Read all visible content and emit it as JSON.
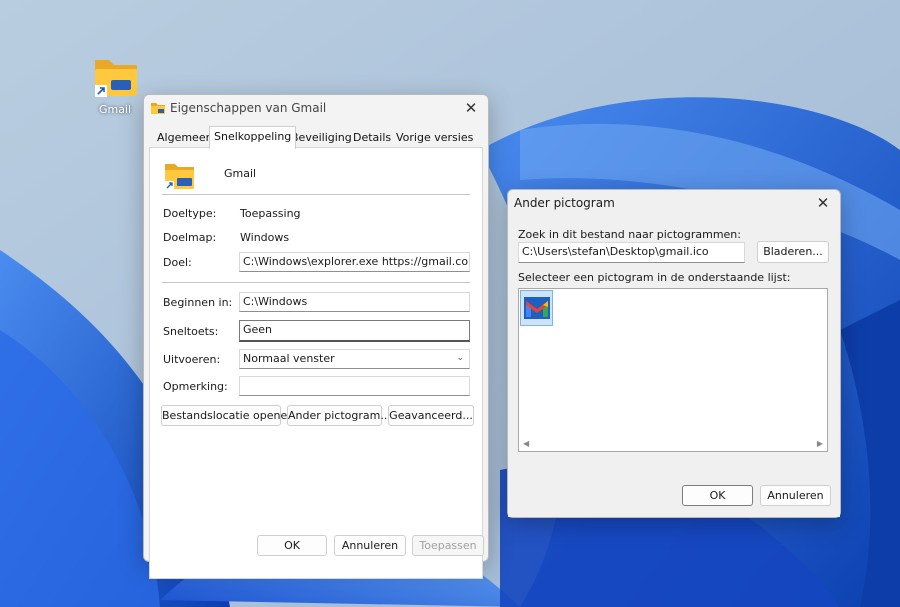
{
  "desktop": {
    "shortcut_label": "Gmail"
  },
  "properties_dialog": {
    "title": "Eigenschappen van Gmail",
    "tabs": [
      {
        "label": "Algemeen",
        "active": false
      },
      {
        "label": "Snelkoppeling",
        "active": true
      },
      {
        "label": "Beveiliging",
        "active": false
      },
      {
        "label": "Details",
        "active": false
      },
      {
        "label": "Vorige versies",
        "active": false
      }
    ],
    "name": "Gmail",
    "target_type_label": "Doeltype:",
    "target_type_value": "Toepassing",
    "target_location_label": "Doelmap:",
    "target_location_value": "Windows",
    "target_label": "Doel:",
    "target_value": "C:\\Windows\\explorer.exe https://gmail.com/",
    "start_in_label": "Beginnen in:",
    "start_in_value": "C:\\Windows",
    "shortcut_key_label": "Sneltoets:",
    "shortcut_key_value": "Geen",
    "run_label": "Uitvoeren:",
    "run_value": "Normaal venster",
    "comment_label": "Opmerking:",
    "comment_value": "",
    "open_location_button": "Bestandslocatie openen",
    "change_icon_button": "Ander pictogram...",
    "advanced_button": "Geavanceerd...",
    "ok_button": "OK",
    "cancel_button": "Annuleren",
    "apply_button": "Toepassen"
  },
  "change_icon_dialog": {
    "title": "Ander pictogram",
    "search_label": "Zoek in dit bestand naar pictogrammen:",
    "file_path": "C:\\Users\\stefan\\Desktop\\gmail.ico",
    "browse_button": "Bladeren...",
    "select_label": "Selecteer een pictogram in de onderstaande lijst:",
    "ok_button": "OK",
    "cancel_button": "Annuleren"
  },
  "colors": {
    "desktop_bg": "#aac0d8",
    "bloom_blue": "#1b5fd6",
    "selection": "#cfe3f6",
    "gmail_red": "#ea4335",
    "gmail_blue": "#4285f4",
    "gmail_green": "#34a853",
    "gmail_yellow": "#fbbc04"
  }
}
